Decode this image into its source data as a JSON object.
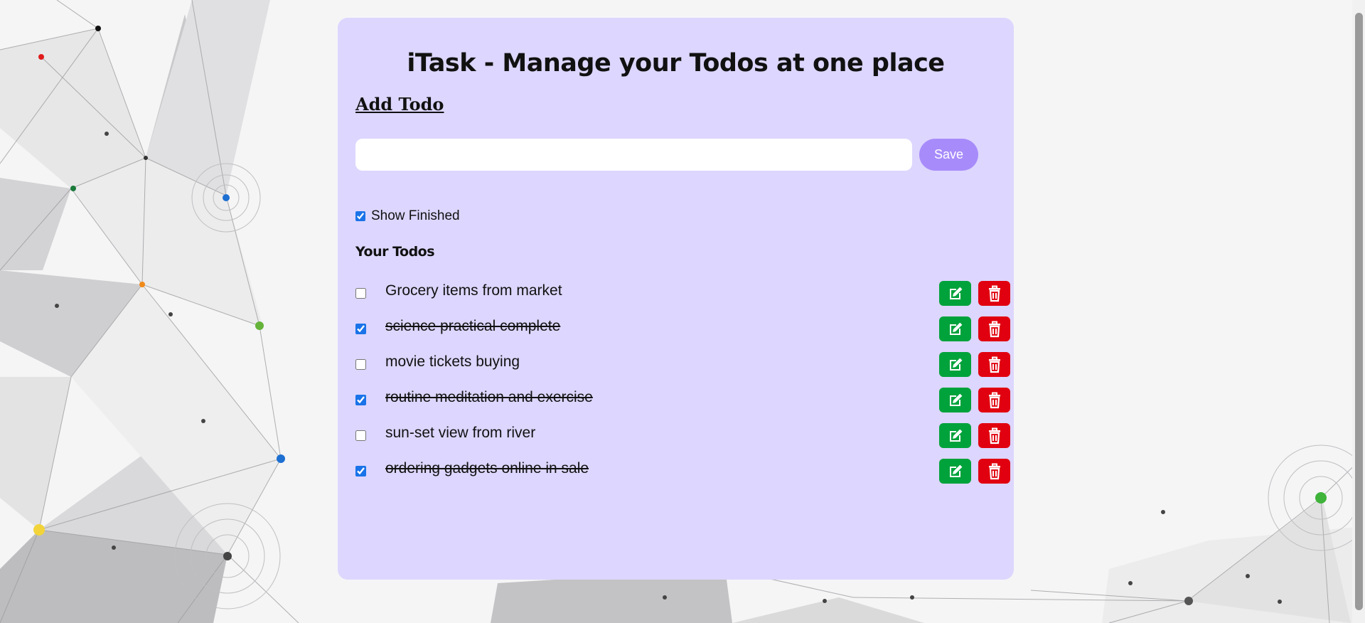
{
  "app": {
    "title": "iTask - Manage your Todos at one place"
  },
  "add": {
    "heading": "Add Todo",
    "input_value": "",
    "input_placeholder": "",
    "save_label": "Save"
  },
  "filter": {
    "show_finished_label": "Show Finished",
    "show_finished_checked": true
  },
  "todos": {
    "heading": "Your Todos",
    "items": [
      {
        "text": "Grocery items from market",
        "done": false
      },
      {
        "text": "science practical complete",
        "done": true
      },
      {
        "text": "movie tickets buying",
        "done": false
      },
      {
        "text": "routine meditation and exercise",
        "done": true
      },
      {
        "text": "sun-set view from river",
        "done": false
      },
      {
        "text": "ordering gadgets online in sale",
        "done": true
      }
    ]
  },
  "icons": {
    "edit": "edit-icon",
    "delete": "trash-icon"
  },
  "colors": {
    "card_bg": "#ddd6fe",
    "save_button": "#a78bfa",
    "edit_button": "#00a23b",
    "delete_button": "#e1000f",
    "checkbox_accent": "#1a73e8"
  }
}
